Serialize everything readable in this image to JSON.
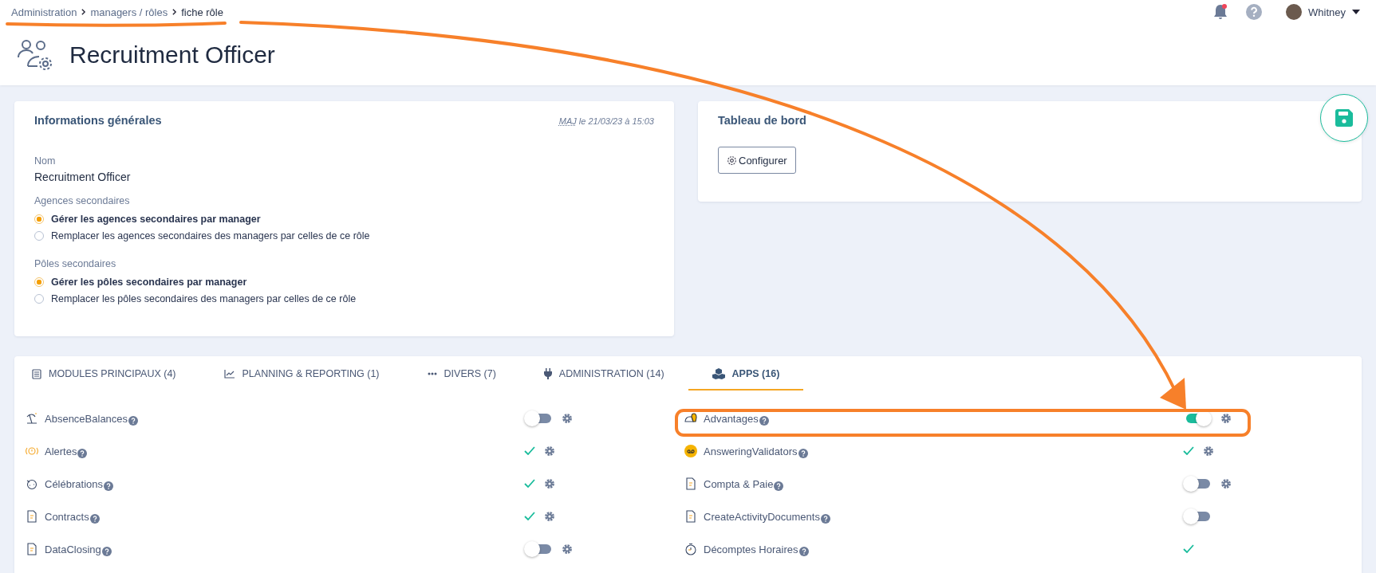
{
  "breadcrumb": [
    {
      "label": "Administration",
      "current": false
    },
    {
      "label": "managers / rôles",
      "current": false
    },
    {
      "label": "fiche rôle",
      "current": true
    }
  ],
  "notifications": {
    "unread": true
  },
  "user": {
    "name": "Whitney"
  },
  "page_title": "Recruitment Officer",
  "general_info": {
    "title": "Informations générales",
    "updated_abbr": "MAJ",
    "updated_text": "le 21/03/23 à 15:03",
    "name_label": "Nom",
    "name_value": "Recruitment Officer",
    "radio_groups": [
      {
        "label": "Agences secondaires",
        "options": [
          {
            "label": "Gérer les agences secondaires par manager",
            "selected": true
          },
          {
            "label": "Remplacer les agences secondaires des managers par celles de ce rôle",
            "selected": false
          }
        ]
      },
      {
        "label": "Pôles secondaires",
        "options": [
          {
            "label": "Gérer les pôles secondaires par manager",
            "selected": true
          },
          {
            "label": "Remplacer les pôles secondaires des managers par celles de ce rôle",
            "selected": false
          }
        ]
      }
    ]
  },
  "dashboard": {
    "title": "Tableau de bord",
    "button": "Configurer"
  },
  "tabs": [
    {
      "label": "MODULES PRINCIPAUX (4)",
      "selected": false
    },
    {
      "label": "PLANNING & REPORTING (1)",
      "selected": false
    },
    {
      "label": "DIVERS (7)",
      "selected": false
    },
    {
      "label": "ADMINISTRATION (14)",
      "selected": false
    },
    {
      "label": "APPS (16)",
      "selected": true
    }
  ],
  "apps": [
    [
      {
        "name": "AbsenceBalances",
        "kind": "toggle",
        "on": false,
        "settings": true
      },
      {
        "name": "Alertes",
        "kind": "check",
        "settings": true
      },
      {
        "name": "Célébrations",
        "kind": "check",
        "settings": true
      },
      {
        "name": "Contracts",
        "kind": "check",
        "settings": true
      },
      {
        "name": "DataClosing",
        "kind": "toggle",
        "on": false,
        "settings": true
      }
    ],
    [
      {
        "name": "Advantages",
        "kind": "toggle",
        "on": true,
        "settings": true
      },
      {
        "name": "AnsweringValidators",
        "kind": "check",
        "settings": true
      },
      {
        "name": "Compta & Paie",
        "kind": "toggle",
        "on": false,
        "settings": true
      },
      {
        "name": "CreateActivityDocuments",
        "kind": "toggle",
        "on": false,
        "settings": false
      },
      {
        "name": "Décomptes Horaires",
        "kind": "check",
        "settings": false
      }
    ]
  ]
}
